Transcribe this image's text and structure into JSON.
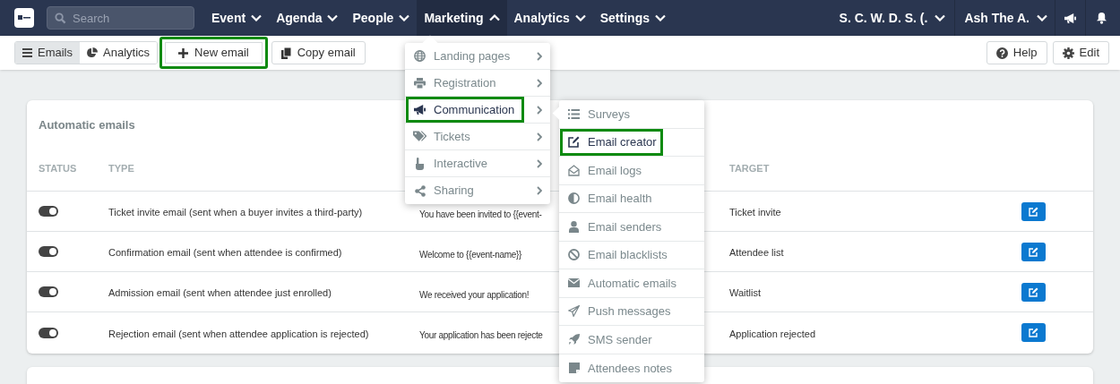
{
  "nav": {
    "search_placeholder": "Search",
    "menus": [
      {
        "label": "Event",
        "expanded": false
      },
      {
        "label": "Agenda",
        "expanded": false
      },
      {
        "label": "People",
        "expanded": false
      },
      {
        "label": "Marketing",
        "expanded": true
      },
      {
        "label": "Analytics",
        "expanded": false
      },
      {
        "label": "Settings",
        "expanded": false
      }
    ],
    "account": [
      "S. C. W. D. S. (.",
      "Ash The A."
    ]
  },
  "toolbar": {
    "view_tabs": [
      {
        "label": "Emails",
        "selected": true
      },
      {
        "label": "Analytics",
        "selected": false
      }
    ],
    "buttons": [
      {
        "label": "New email",
        "highlighted": true
      },
      {
        "label": "Copy email",
        "highlighted": false
      }
    ],
    "right_buttons": [
      "Help",
      "Edit"
    ]
  },
  "card": {
    "title": "Automatic emails",
    "columns": [
      "STATUS",
      "TYPE",
      "TARGET"
    ],
    "rows": [
      {
        "on": true,
        "type": "Ticket invite email (sent when a buyer invites a third-party)",
        "subject": "You have been invited to {{event-",
        "target": "Ticket invite"
      },
      {
        "on": true,
        "type": "Confirmation email (sent when attendee is confirmed)",
        "subject": "Welcome to {{event-name}}",
        "target": "Attendee list"
      },
      {
        "on": true,
        "type": "Admission email (sent when attendee just enrolled)",
        "subject": "We received your application!",
        "target": "Waitlist"
      },
      {
        "on": true,
        "type": "Rejection email (sent when attendee application is rejected)",
        "subject": "Your application has been rejecte",
        "target": "Application rejected"
      }
    ]
  },
  "marketing_menu": {
    "items": [
      {
        "label": "Landing pages",
        "selected": false,
        "highlighted": false
      },
      {
        "label": "Registration",
        "selected": false,
        "highlighted": false
      },
      {
        "label": "Communication",
        "selected": true,
        "highlighted": true
      },
      {
        "label": "Tickets",
        "selected": false,
        "highlighted": false
      },
      {
        "label": "Interactive",
        "selected": false,
        "highlighted": false
      },
      {
        "label": "Sharing",
        "selected": false,
        "highlighted": false
      }
    ]
  },
  "communication_menu": {
    "items": [
      {
        "label": "Surveys",
        "selected": false,
        "highlighted": false
      },
      {
        "label": "Email creator",
        "selected": true,
        "highlighted": true
      },
      {
        "label": "Email logs",
        "selected": false,
        "highlighted": false
      },
      {
        "label": "Email health",
        "selected": false,
        "highlighted": false
      },
      {
        "label": "Email senders",
        "selected": false,
        "highlighted": false
      },
      {
        "label": "Email blacklists",
        "selected": false,
        "highlighted": false
      },
      {
        "label": "Automatic emails",
        "selected": false,
        "highlighted": false
      },
      {
        "label": "Push messages",
        "selected": false,
        "highlighted": false
      },
      {
        "label": "SMS sender",
        "selected": false,
        "highlighted": false
      },
      {
        "label": "Attendees notes",
        "selected": false,
        "highlighted": false
      }
    ]
  }
}
